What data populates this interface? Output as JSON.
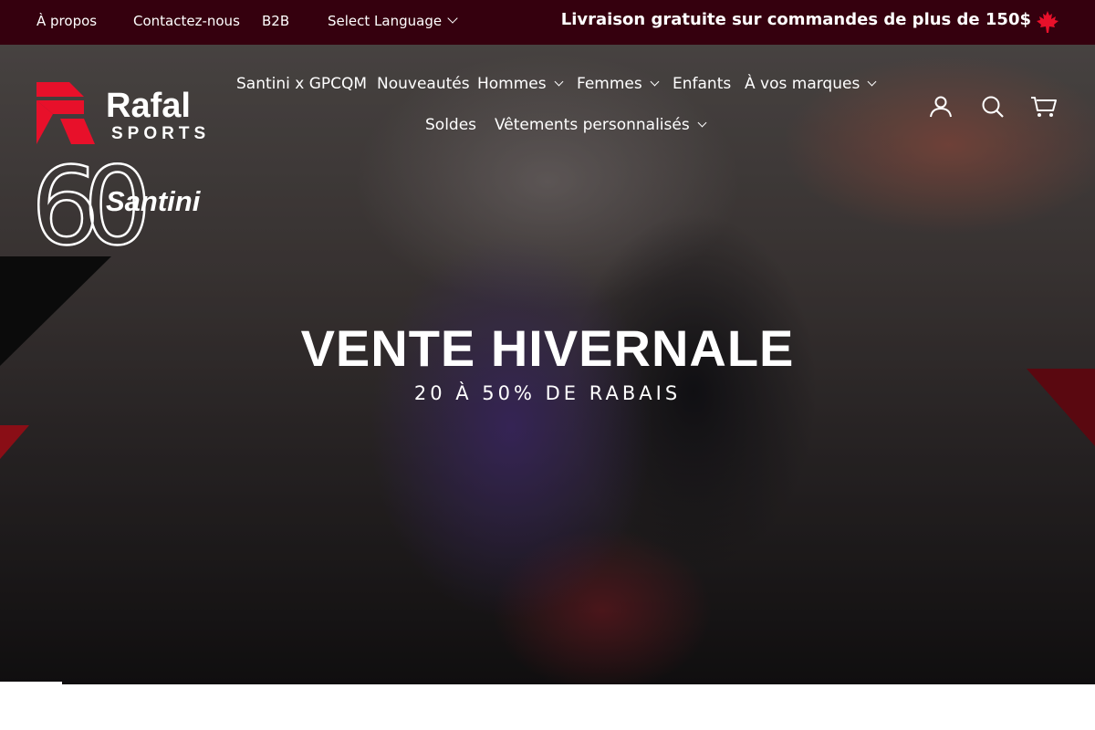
{
  "topbar": {
    "links": [
      "À propos",
      "Contactez-nous",
      "B2B"
    ],
    "language_label": "Select Language",
    "promo": "Livraison gratuite sur commandes de plus de 150$"
  },
  "brand": {
    "logo_text": "Rafal",
    "logo_sub": "SPORTS",
    "partner_number": "60",
    "partner_name": "Santini"
  },
  "nav": {
    "items": [
      {
        "label": "Santini x GPCQM",
        "dropdown": false
      },
      {
        "label": "Nouveautés",
        "dropdown": false
      },
      {
        "label": "Hommes",
        "dropdown": true
      },
      {
        "label": "Femmes",
        "dropdown": true
      },
      {
        "label": "Enfants",
        "dropdown": false
      },
      {
        "label": "À vos marques",
        "dropdown": true
      },
      {
        "label": "Soldes",
        "dropdown": false
      },
      {
        "label": "Vêtements personnalisés",
        "dropdown": true
      }
    ]
  },
  "header_icons": [
    "account-icon",
    "search-icon",
    "cart-icon"
  ],
  "hero": {
    "title": "VENTE HIVERNALE",
    "subtitle": "20 À 50% DE RABAIS"
  },
  "colors": {
    "topbar_bg": "#35000e",
    "brand_red": "#e8102a"
  }
}
